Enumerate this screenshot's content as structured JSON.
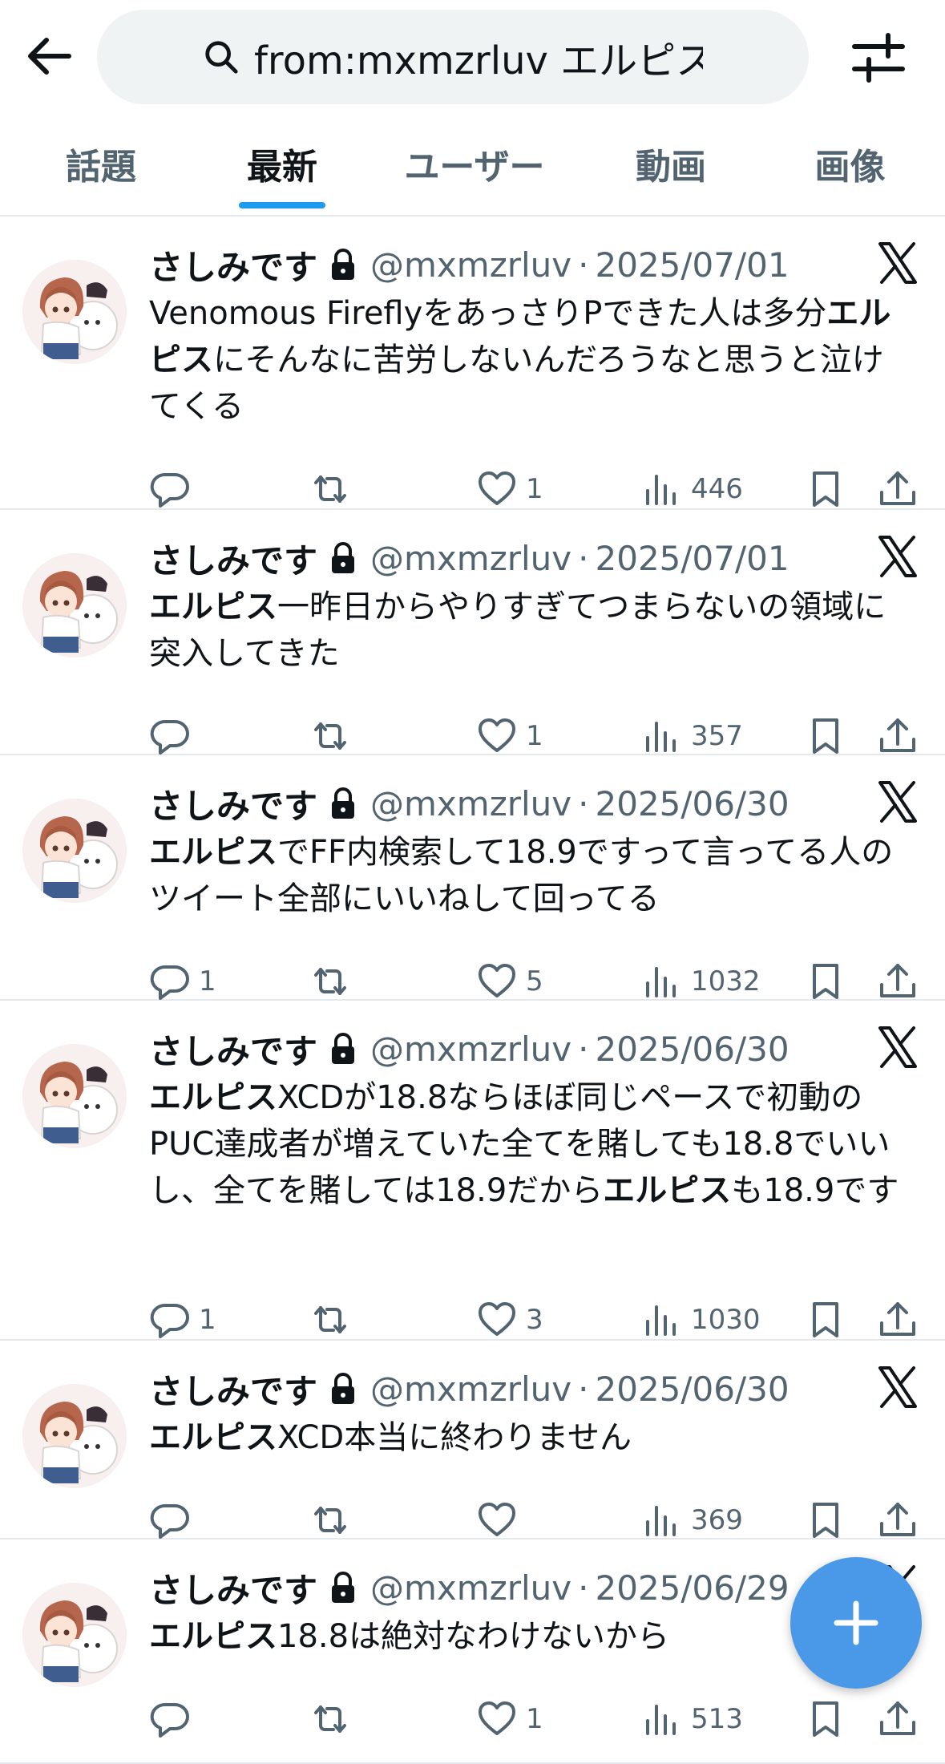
{
  "search": {
    "query": "from:mxmzrluv エルピス"
  },
  "tabs": [
    {
      "label": "話題"
    },
    {
      "label": "最新",
      "active": true
    },
    {
      "label": "ユーザー"
    },
    {
      "label": "動画"
    },
    {
      "label": "画像"
    }
  ],
  "colors": {
    "accent": "#1d9bf0",
    "fab": "#4a99e9",
    "secondary_text": "#536471"
  },
  "tweets": [
    {
      "name": "さしみです",
      "handle": "@mxmzrluv",
      "dot": "·",
      "date": "2025/07/01",
      "text_parts": [
        {
          "t": "Venomous FireflyをあっさりPできた人は多分"
        },
        {
          "t": "エルピス",
          "b": true
        },
        {
          "t": "にそんなに苦労しないんだろうなと思うと泣けてくる"
        }
      ],
      "replies": "",
      "retweets": "",
      "likes": "1",
      "views": "446"
    },
    {
      "name": "さしみです",
      "handle": "@mxmzrluv",
      "dot": "·",
      "date": "2025/07/01",
      "text_parts": [
        {
          "t": "エルピス",
          "b": true
        },
        {
          "t": "一昨日からやりすぎてつまらないの領域に突入してきた"
        }
      ],
      "replies": "",
      "retweets": "",
      "likes": "1",
      "views": "357"
    },
    {
      "name": "さしみです",
      "handle": "@mxmzrluv",
      "dot": "·",
      "date": "2025/06/30",
      "text_parts": [
        {
          "t": "エルピス",
          "b": true
        },
        {
          "t": "でFF内検索して18.9ですって言ってる人のツイート全部にいいねして回ってる"
        }
      ],
      "replies": "1",
      "retweets": "",
      "likes": "5",
      "views": "1032"
    },
    {
      "name": "さしみです",
      "handle": "@mxmzrluv",
      "dot": "·",
      "date": "2025/06/30",
      "text_parts": [
        {
          "t": "エルピス",
          "b": true
        },
        {
          "t": "XCDが18.8ならほぼ同じペースで初動のPUC達成者が増えていた全てを賭しても18.8でいいし、全てを賭しては18.9だから"
        },
        {
          "t": "エルピス",
          "b": true
        },
        {
          "t": "も18.9です"
        }
      ],
      "replies": "1",
      "retweets": "",
      "likes": "3",
      "views": "1030"
    },
    {
      "name": "さしみです",
      "handle": "@mxmzrluv",
      "dot": "·",
      "date": "2025/06/30",
      "text_parts": [
        {
          "t": "エルピス",
          "b": true
        },
        {
          "t": "XCD本当に終わりません"
        }
      ],
      "replies": "",
      "retweets": "",
      "likes": "",
      "views": "369"
    },
    {
      "name": "さしみです",
      "handle": "@mxmzrluv",
      "dot": "·",
      "date": "2025/06/29",
      "text_parts": [
        {
          "t": "エルピス",
          "b": true
        },
        {
          "t": "18.8は絶対なわけないから"
        }
      ],
      "replies": "",
      "retweets": "",
      "likes": "1",
      "views": "513"
    }
  ],
  "icons": {
    "back": "arrow-left-icon",
    "search": "search-icon",
    "filter": "sliders-icon",
    "lock": "lock-icon",
    "x_logo": "x-logo-icon",
    "reply": "reply-icon",
    "retweet": "retweet-icon",
    "like": "heart-icon",
    "views": "views-icon",
    "bookmark": "bookmark-icon",
    "share": "share-icon",
    "compose": "plus-icon"
  }
}
